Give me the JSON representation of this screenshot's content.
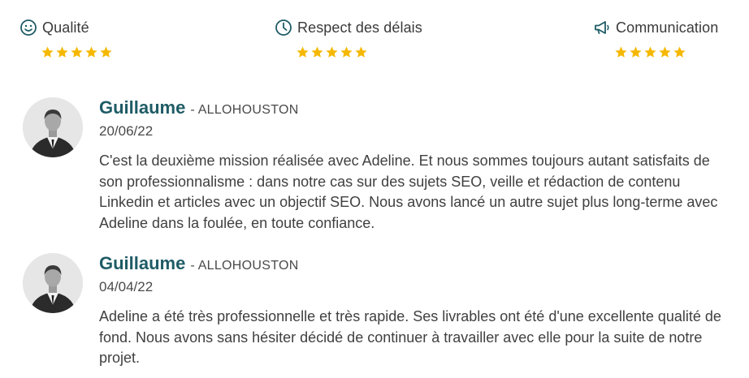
{
  "ratings": [
    {
      "icon": "smile-icon",
      "label": "Qualité",
      "stars": 5
    },
    {
      "icon": "clock-icon",
      "label": "Respect des délais",
      "stars": 5
    },
    {
      "icon": "megaphone-icon",
      "label": "Communication",
      "stars": 5
    }
  ],
  "reviews": [
    {
      "name": "Guillaume",
      "separator": "-",
      "company": "ALLOHOUSTON",
      "date": "20/06/22",
      "text": "C'est la deuxième mission réalisée avec Adeline. Et nous sommes toujours autant satisfaits de son professionnalisme : dans notre cas sur des sujets SEO, veille et rédaction de contenu Linkedin et articles avec un objectif SEO. Nous avons lancé un autre sujet plus long-terme avec Adeline dans la foulée, en toute confiance."
    },
    {
      "name": "Guillaume",
      "separator": "-",
      "company": "ALLOHOUSTON",
      "date": "04/04/22",
      "text": "Adeline a été très professionnelle et très rapide. Ses livrables ont été d'une excellente qualité de fond. Nous avons sans hésiter décidé de continuer à travailler avec elle pour la suite de notre projet."
    }
  ],
  "colors": {
    "accent": "#1f5c66",
    "star": "#f5b800",
    "text": "#404040"
  }
}
